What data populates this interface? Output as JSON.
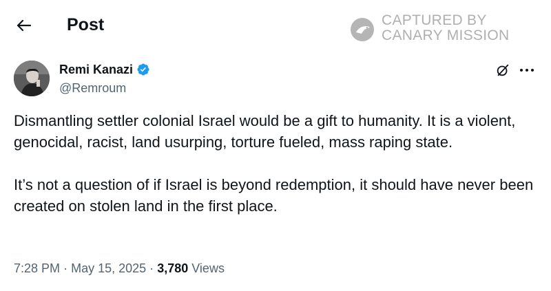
{
  "header": {
    "title": "Post",
    "back_icon": "arrow-left-icon"
  },
  "watermark": {
    "line1": "CAPTURED BY",
    "line2": "CANARY MISSION",
    "logo_icon": "canary-bird-logo"
  },
  "author": {
    "display_name": "Remi Kanazi",
    "handle": "@Remroum",
    "verified": true,
    "verified_color": "#1d9bf0"
  },
  "actions": {
    "grok_icon": "grok-icon",
    "more_icon": "more-horizontal-icon"
  },
  "tweet": {
    "paragraphs": [
      "Dismantling settler colonial Israel would be a gift to humanity. It is a violent, genocidal, racist, land usurping, torture fueled, mass raping state.",
      "It’s not a question of if Israel is beyond redemption, it should have never been created on stolen land in the first place."
    ]
  },
  "meta": {
    "time": "7:28 PM",
    "separator": "·",
    "date": "May 15, 2025",
    "views_count": "3,780",
    "views_label": "Views"
  }
}
